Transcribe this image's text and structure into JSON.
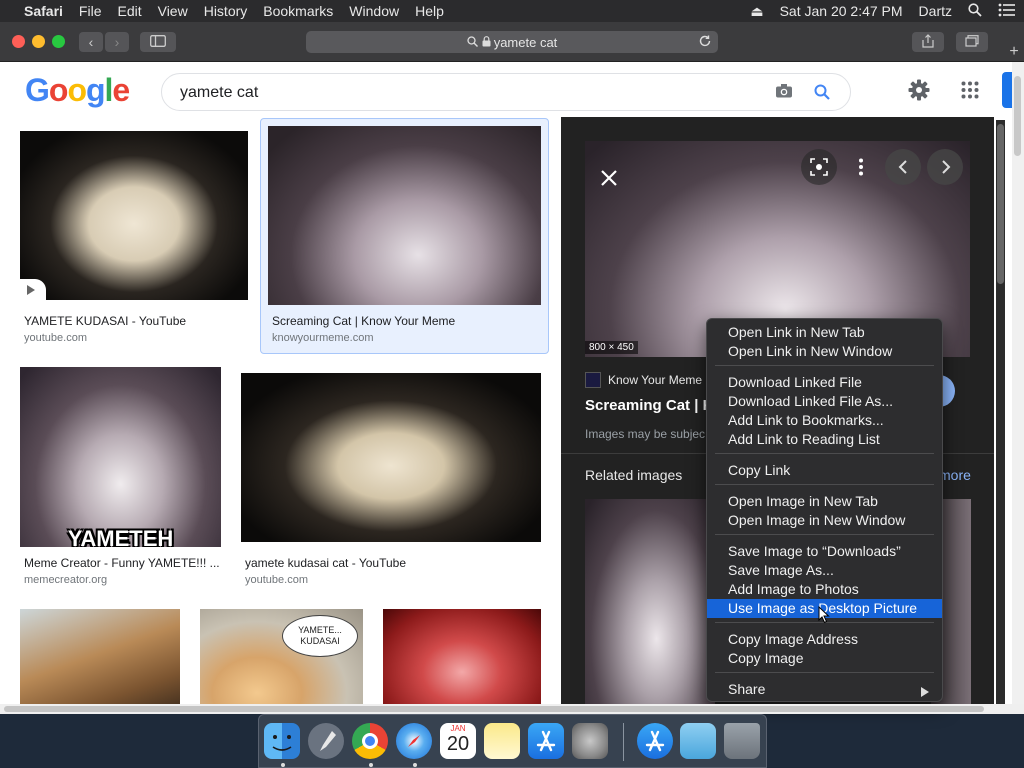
{
  "menubar": {
    "apple": "",
    "app_name": "Safari",
    "items": [
      "File",
      "Edit",
      "View",
      "History",
      "Bookmarks",
      "Window",
      "Help"
    ],
    "clock": "Sat Jan 20  2:47 PM",
    "user": "Dartz"
  },
  "browser": {
    "url": "yamete cat",
    "back_label": "‹",
    "forward_label": "›"
  },
  "google": {
    "logo": "Google",
    "query": "yamete cat"
  },
  "results": [
    {
      "title": "YAMETE KUDASAI - YouTube",
      "source": "youtube.com"
    },
    {
      "title": "Screaming Cat | Know Your Meme",
      "source": "knowyourmeme.com"
    },
    {
      "title": "Meme Creator - Funny YAMETE!!! ...",
      "source": "memecreator.org",
      "overlay": "YAMETEH"
    },
    {
      "title": "yamete kudasai cat - YouTube",
      "source": "youtube.com"
    },
    {
      "title": "",
      "source": ""
    },
    {
      "title": "",
      "source": "",
      "overlay": "YAMETE... KUDASAI"
    },
    {
      "title": "",
      "source": ""
    }
  ],
  "side_panel": {
    "dimensions": "800 × 450",
    "site_name": "Know Your Meme",
    "title": "Screaming Cat | Kn",
    "notice": "Images may be subjec",
    "related_heading": "Related images",
    "more_label": "more"
  },
  "context_menu": {
    "groups": [
      [
        "Open Link in New Tab",
        "Open Link in New Window"
      ],
      [
        "Download Linked File",
        "Download Linked File As...",
        "Add Link to Bookmarks...",
        "Add Link to Reading List"
      ],
      [
        "Copy Link"
      ],
      [
        "Open Image in New Tab",
        "Open Image in New Window"
      ],
      [
        "Save Image to “Downloads”",
        "Save Image As...",
        "Add Image to Photos",
        "Use Image as Desktop Picture"
      ],
      [
        "Copy Image Address",
        "Copy Image"
      ],
      [
        "Share"
      ]
    ],
    "highlighted": "Use Image as Desktop Picture"
  },
  "dock": {
    "calendar_month": "JAN",
    "calendar_day": "20"
  },
  "colors": {
    "highlight": "#1764d8",
    "link_blue": "#8ab4f8",
    "google_blue": "#4285F4",
    "google_red": "#EA4335",
    "google_yellow": "#FBBC05",
    "google_green": "#34A853"
  }
}
